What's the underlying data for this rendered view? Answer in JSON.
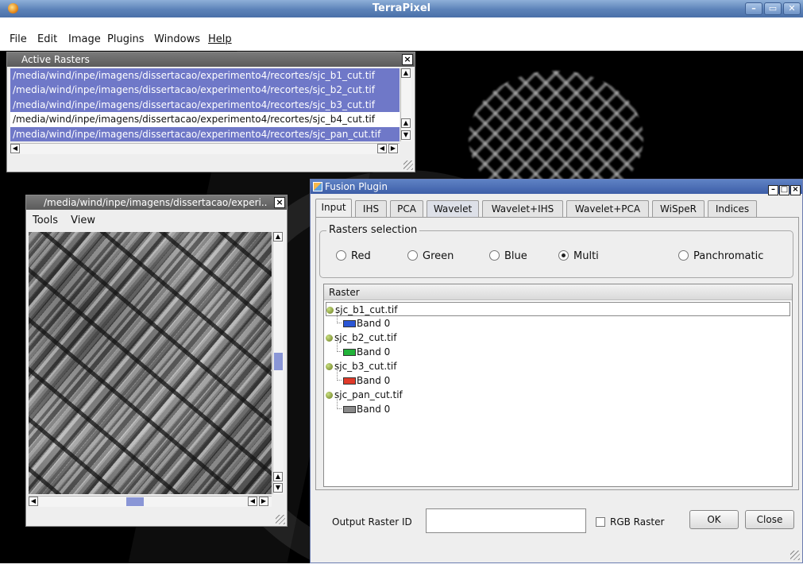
{
  "window": {
    "title": "TerraPixel",
    "controls": {
      "minimize": "–",
      "maximize": "▭",
      "close": "✕"
    }
  },
  "menubar": {
    "items": [
      "File",
      "Edit",
      "Image",
      "Plugins",
      "Windows",
      "Help"
    ]
  },
  "active_rasters": {
    "title": "Active Rasters",
    "files": [
      {
        "path": "/media/wind/inpe/imagens/dissertacao/experimento4/recortes/sjc_b1_cut.tif",
        "selected": true
      },
      {
        "path": "/media/wind/inpe/imagens/dissertacao/experimento4/recortes/sjc_b2_cut.tif",
        "selected": true
      },
      {
        "path": "/media/wind/inpe/imagens/dissertacao/experimento4/recortes/sjc_b3_cut.tif",
        "selected": true
      },
      {
        "path": "/media/wind/inpe/imagens/dissertacao/experimento4/recortes/sjc_b4_cut.tif",
        "selected": false
      },
      {
        "path": "/media/wind/inpe/imagens/dissertacao/experimento4/recortes/sjc_pan_cut.tif",
        "selected": true
      }
    ]
  },
  "viewer": {
    "title": "/media/wind/inpe/imagens/dissertacao/experi..",
    "menu": [
      "Tools",
      "View"
    ]
  },
  "fusion": {
    "title": "Fusion Plugin",
    "tabs": [
      "Input",
      "IHS",
      "PCA",
      "Wavelet",
      "Wavelet+IHS",
      "Wavelet+PCA",
      "WiSpeR",
      "Indices"
    ],
    "active_tab": "Input",
    "rasters_selection": {
      "legend": "Rasters selection",
      "options": [
        "Red",
        "Green",
        "Blue",
        "Multi",
        "Panchromatic"
      ],
      "selected": "Multi"
    },
    "tree": {
      "header": "Raster",
      "nodes": [
        {
          "file": "sjc_b1_cut.tif",
          "band": "Band 0",
          "color": "#2a56d6"
        },
        {
          "file": "sjc_b2_cut.tif",
          "band": "Band 0",
          "color": "#22b33a"
        },
        {
          "file": "sjc_b3_cut.tif",
          "band": "Band 0",
          "color": "#e03a2a"
        },
        {
          "file": "sjc_pan_cut.tif",
          "band": "Band 0",
          "color": "#8a8a8a"
        }
      ]
    },
    "output_label": "Output Raster ID",
    "output_value": "",
    "rgb_label": "RGB Raster",
    "rgb_checked": false,
    "ok_label": "OK",
    "close_label": "Close"
  }
}
